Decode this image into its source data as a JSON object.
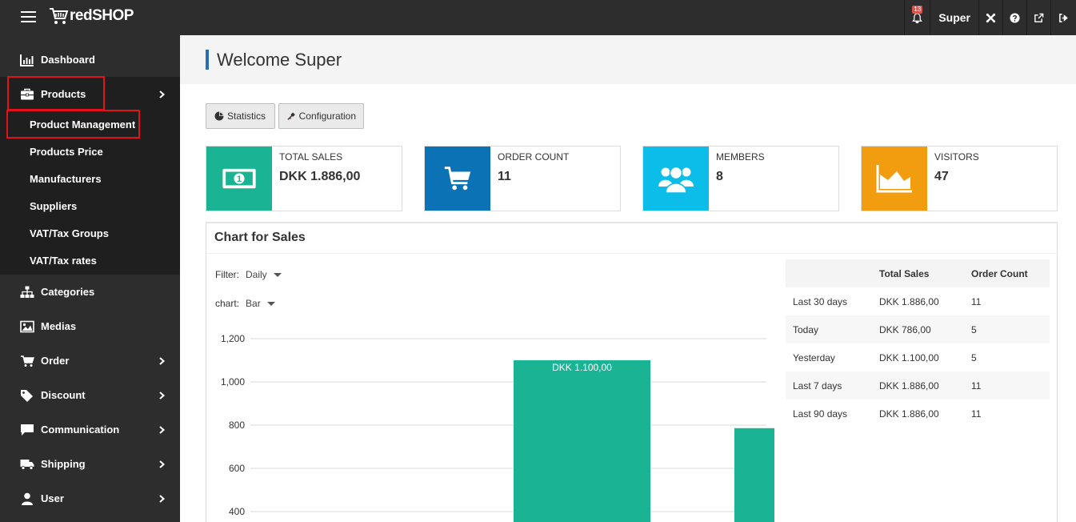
{
  "app": {
    "logo_text": "redSHOP",
    "notification_count": "13",
    "user_name": "Super"
  },
  "sidebar": {
    "items": [
      {
        "label": "Dashboard",
        "icon": "bar-chart-icon"
      },
      {
        "label": "Products",
        "icon": "briefcase-icon"
      },
      {
        "label": "Categories",
        "icon": "sitemap-icon"
      },
      {
        "label": "Medias",
        "icon": "image-icon"
      },
      {
        "label": "Order",
        "icon": "cart-icon"
      },
      {
        "label": "Discount",
        "icon": "tag-icon"
      },
      {
        "label": "Communication",
        "icon": "comment-icon"
      },
      {
        "label": "Shipping",
        "icon": "truck-icon"
      },
      {
        "label": "User",
        "icon": "user-icon"
      }
    ],
    "products_submenu": [
      "Product Management",
      "Products Price",
      "Manufacturers",
      "Suppliers",
      "VAT/Tax Groups",
      "VAT/Tax rates"
    ]
  },
  "header": {
    "title": "Welcome Super"
  },
  "toolbar": {
    "statistics_label": "Statistics",
    "configuration_label": "Configuration"
  },
  "stats": [
    {
      "label": "TOTAL SALES",
      "value": "DKK 1.886,00",
      "color": "#1ab394",
      "icon": "money-icon"
    },
    {
      "label": "ORDER COUNT",
      "value": "11",
      "color": "#0a72b5",
      "icon": "cart-icon"
    },
    {
      "label": "MEMBERS",
      "value": "8",
      "color": "#0bbde8",
      "icon": "users-icon"
    },
    {
      "label": "VISITORS",
      "value": "47",
      "color": "#f29c0f",
      "icon": "area-chart-icon"
    }
  ],
  "panel": {
    "title": "Chart for Sales",
    "filter_label": "Filter:",
    "filter_value": "Daily",
    "chart_label": "chart:",
    "chart_value": "Bar"
  },
  "summary_table": {
    "headers": [
      "",
      "Total Sales",
      "Order Count"
    ],
    "rows": [
      [
        "Last 30 days",
        "DKK 1.886,00",
        "11"
      ],
      [
        "Today",
        "DKK 786,00",
        "5"
      ],
      [
        "Yesterday",
        "DKK 1.100,00",
        "5"
      ],
      [
        "Last 7 days",
        "DKK 1.886,00",
        "11"
      ],
      [
        "Last 90 days",
        "DKK 1.886,00",
        "11"
      ]
    ]
  },
  "chart_data": {
    "type": "bar",
    "y_ticks": [
      "1,200",
      "1,000",
      "800",
      "600",
      "400"
    ],
    "ylim": [
      400,
      1200
    ],
    "bars": [
      {
        "value": 1100,
        "label": "DKK 1.100,00"
      },
      {
        "value": 786,
        "label": ""
      }
    ],
    "bar_color": "#1ab394"
  }
}
